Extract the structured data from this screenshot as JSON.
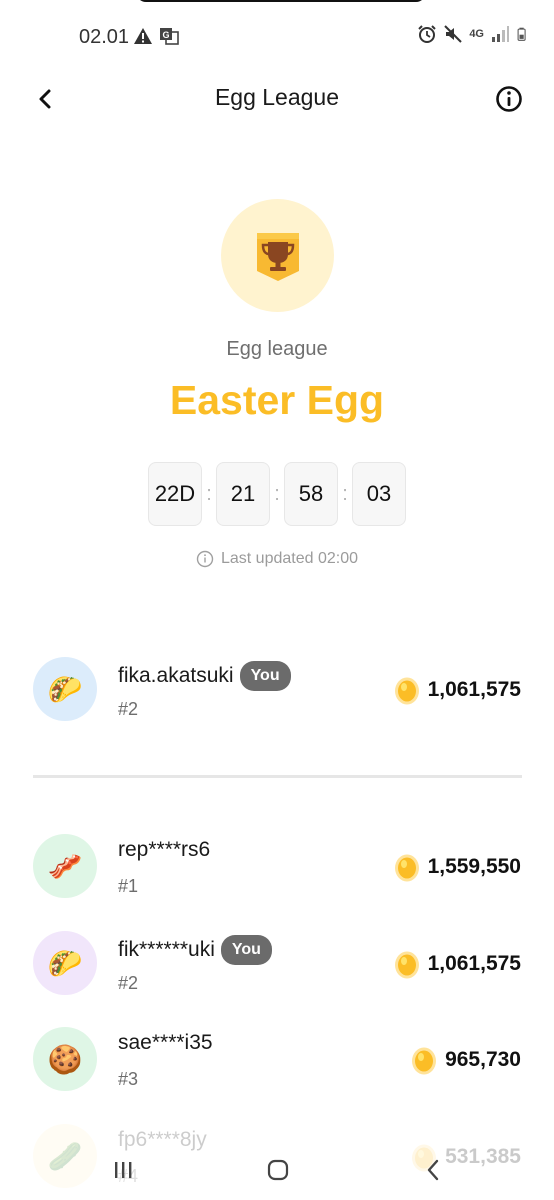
{
  "status_bar": {
    "time": "02.01",
    "icons": [
      "warning-icon",
      "translate-icon",
      "alarm-icon",
      "mute-icon",
      "network-4g-icon",
      "signal-icon",
      "battery-icon"
    ],
    "network_label": "4G"
  },
  "header": {
    "title": "Egg League",
    "back_icon": "chevron-left-icon",
    "info_icon": "info-icon"
  },
  "league": {
    "icon": "trophy-icon",
    "subtitle": "Egg league",
    "name": "Easter Egg",
    "name_color": "#fbbd26"
  },
  "countdown": {
    "days": "22D",
    "hours": "21",
    "minutes": "58",
    "seconds": "03",
    "separator": ":"
  },
  "last_updated": "Last updated 02:00",
  "current_user": {
    "name": "fika.akatsuki",
    "badge": "You",
    "rank": "#2",
    "score": "1,061,575",
    "avatar": "taco"
  },
  "leaderboard": [
    {
      "name": "rep****rs6",
      "rank": "#1",
      "score": "1,559,550",
      "avatar": "bacon",
      "badge": ""
    },
    {
      "name": "fik******uki",
      "rank": "#2",
      "score": "1,061,575",
      "avatar": "taco",
      "badge": "You"
    },
    {
      "name": "sae****i35",
      "rank": "#3",
      "score": "965,730",
      "avatar": "cookie",
      "badge": ""
    },
    {
      "name": "fp6****8jy",
      "rank": "#4",
      "score": "531,385",
      "avatar": "cucumber",
      "badge": ""
    }
  ],
  "colors": {
    "accent": "#fbbd26",
    "avatar_blue": "#dcecfb",
    "avatar_green": "#dff6e6",
    "avatar_purple": "#f1e6fb",
    "avatar_yellow": "#fff3cf",
    "badge_gray": "#6b6b6b"
  },
  "nav": {
    "recents_icon": "recent-apps-icon",
    "home_icon": "home-icon",
    "back_icon": "back-icon"
  }
}
